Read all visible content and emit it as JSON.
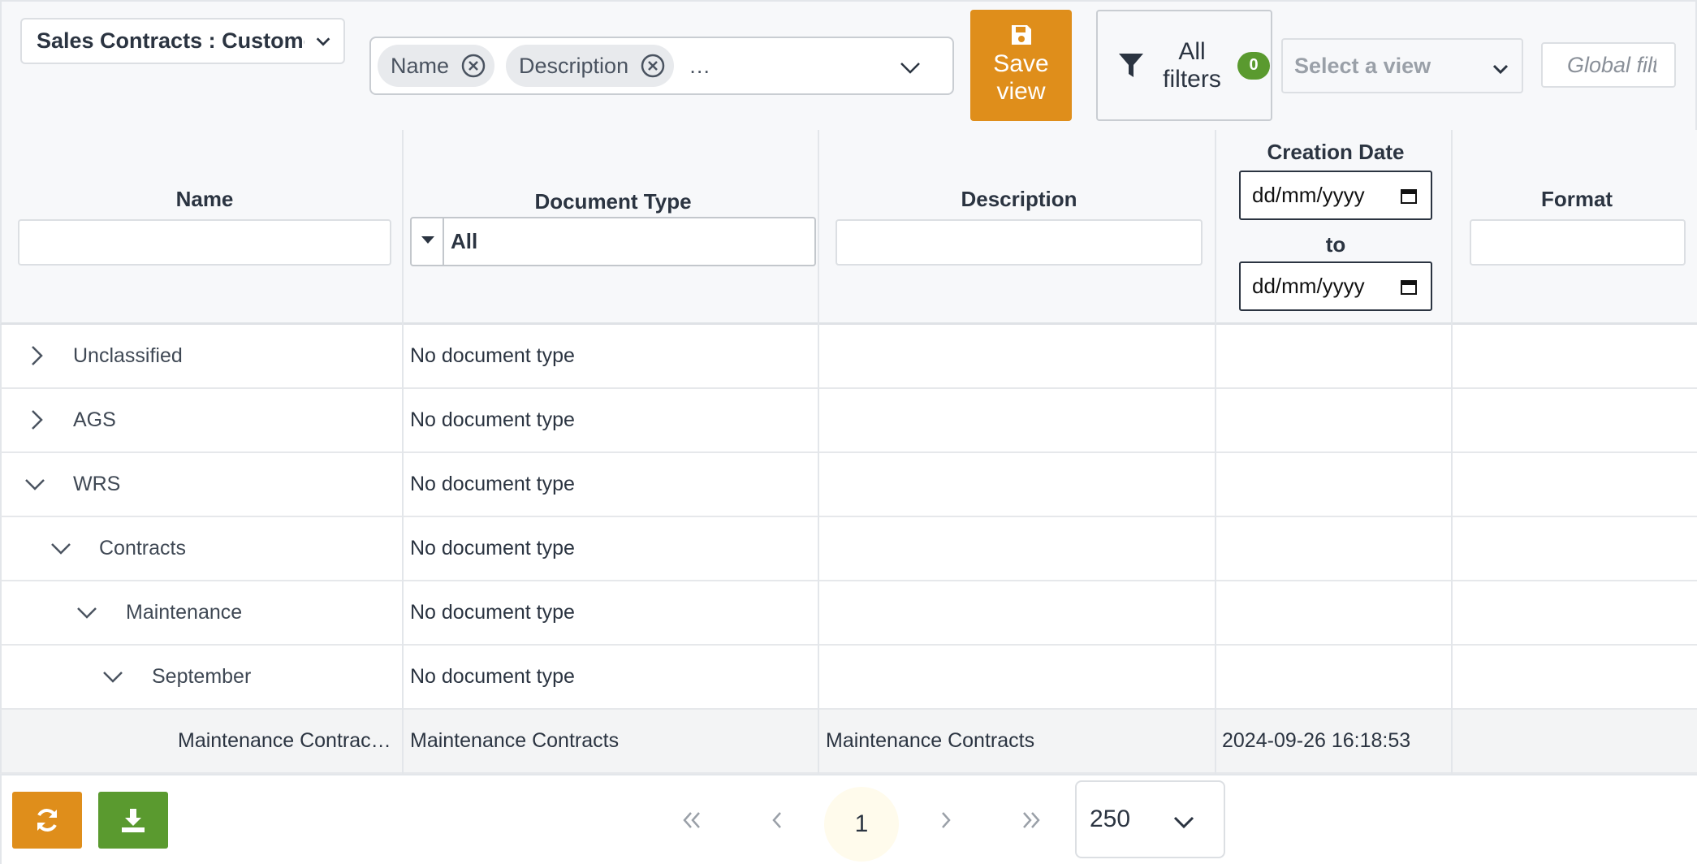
{
  "toolbar": {
    "table_select": "Sales Contracts : Customer",
    "column_chips": [
      "Name",
      "Description"
    ],
    "chips_more": "…",
    "save_view_line1": "Save",
    "save_view_line2": "view",
    "all_filters_line1": "All",
    "all_filters_line2": "filters",
    "filter_count": "0",
    "view_placeholder": "Select a view",
    "global_filter_placeholder": "Global filter"
  },
  "columns": {
    "name": "Name",
    "document_type": "Document Type",
    "document_type_value": "All",
    "description": "Description",
    "creation_date": "Creation Date",
    "date_from_placeholder": "dd/mm/yyyy",
    "date_to_label": "to",
    "date_to_placeholder": "dd/mm/yyyy",
    "format": "Format"
  },
  "rows": [
    {
      "name": "Unclassified",
      "doc_type": "No document type",
      "description": "",
      "created": "",
      "state": "collapsed",
      "level": 0
    },
    {
      "name": "AGS",
      "doc_type": "No document type",
      "description": "",
      "created": "",
      "state": "collapsed",
      "level": 0
    },
    {
      "name": "WRS",
      "doc_type": "No document type",
      "description": "",
      "created": "",
      "state": "expanded",
      "level": 0
    },
    {
      "name": "Contracts",
      "doc_type": "No document type",
      "description": "",
      "created": "",
      "state": "expanded",
      "level": 1
    },
    {
      "name": "Maintenance",
      "doc_type": "No document type",
      "description": "",
      "created": "",
      "state": "expanded",
      "level": 2
    },
    {
      "name": "September",
      "doc_type": "No document type",
      "description": "",
      "created": "",
      "state": "expanded",
      "level": 3
    },
    {
      "name": "Maintenance Contrac…",
      "doc_type": "Maintenance Contracts",
      "description": "Maintenance Contracts",
      "created": "2024-09-26 16:18:53",
      "state": "leaf",
      "level": 4
    }
  ],
  "pagination": {
    "current_page": "1",
    "page_size": "250"
  },
  "colors": {
    "accent_orange": "#df8e1b",
    "accent_green": "#5a9a2f"
  },
  "icons": {
    "save": "floppy-disk-icon",
    "filter": "funnel-icon",
    "refresh": "refresh-icon",
    "download": "download-icon"
  }
}
